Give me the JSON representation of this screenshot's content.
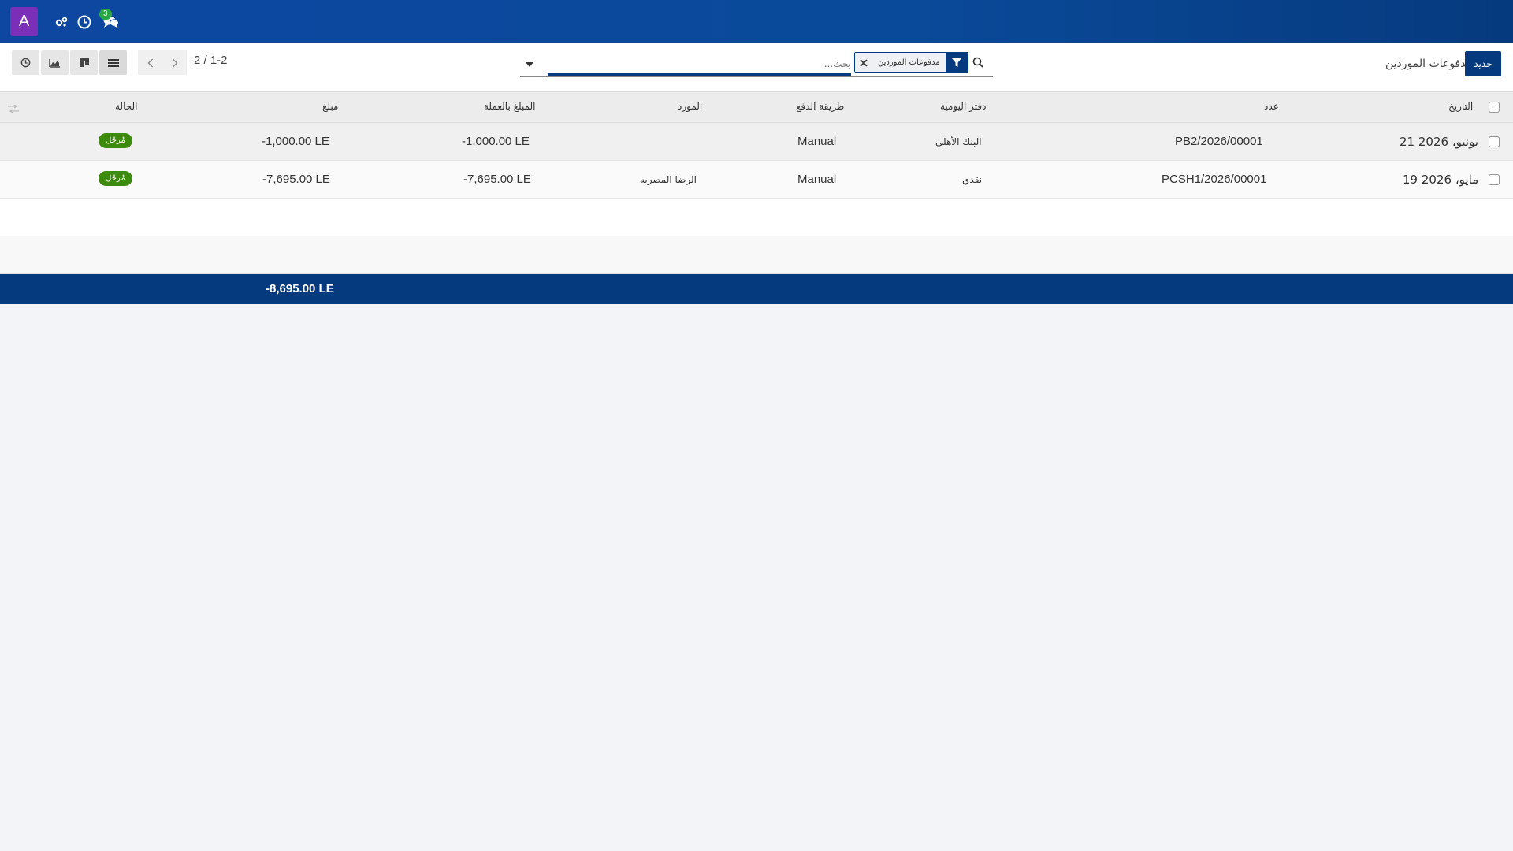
{
  "navbar": {
    "avatar_letter": "A",
    "chat_badge": "3",
    "icons": [
      "settings-icon",
      "clock-icon",
      "chat-icon"
    ]
  },
  "control_panel": {
    "breadcrumb": "مدفوعات الموردين",
    "new_label": "جديد",
    "pager_value": "2 / 1-2",
    "search": {
      "placeholder": "بحث...",
      "facet": "مدفوعات الموردين"
    }
  },
  "table": {
    "headers": {
      "date": "التاريخ",
      "number": "عدد",
      "journal": "دفتر اليومية",
      "payment_method": "طريقة الدفع",
      "vendor": "المورد",
      "amount_currency": "المبلغ بالعملة",
      "amount": "مبلغ",
      "status": "الحالة"
    },
    "rows": [
      {
        "date": "21 يونيو، 2026",
        "number": "PB2/2026/00001",
        "journal": "البنك الأهلي",
        "payment_method": "Manual",
        "vendor": "",
        "amount_currency": "-1,000.00 LE",
        "amount": "-1,000.00 LE",
        "status": "مُرحّل"
      },
      {
        "date": "19 مايو، 2026",
        "number": "PCSH1/2026/00001",
        "journal": "نقدي",
        "payment_method": "Manual",
        "vendor": "الرضا المصريه",
        "amount_currency": "-7,695.00 LE",
        "amount": "-7,695.00 LE",
        "status": "مُرحّل"
      }
    ],
    "total": "-8,695.00 LE"
  },
  "colors": {
    "navbar": "#0d47a1",
    "primary": "#063a7e",
    "avatar": "#7b2fb8",
    "status_posted": "#3c8a0e",
    "badge": "#28a745"
  }
}
